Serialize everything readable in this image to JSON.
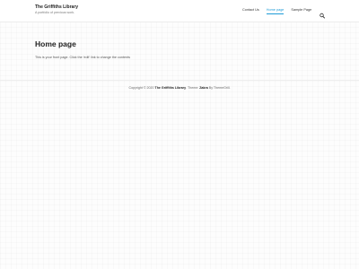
{
  "header": {
    "site_title": "The Griffiths Library",
    "site_description": "A portfolio of previous work.",
    "nav": [
      {
        "label": "Contact Us",
        "active": false
      },
      {
        "label": "Home page",
        "active": true
      },
      {
        "label": "Sample Page",
        "active": false
      }
    ],
    "search_icon": "search-icon"
  },
  "main": {
    "page_title": "Home page",
    "page_text": "This is your front page. Click the 'edit' link to change the contents"
  },
  "footer": {
    "copyright_prefix": "Copyright © 2020",
    "site_link": "The Griffiths Library",
    "theme_prefix": ". Theme:",
    "theme_link": "Zakra",
    "by_text": "By ThemeGrill."
  },
  "colors": {
    "accent": "#1e9bd7",
    "title": "#222222",
    "text": "#555555"
  }
}
